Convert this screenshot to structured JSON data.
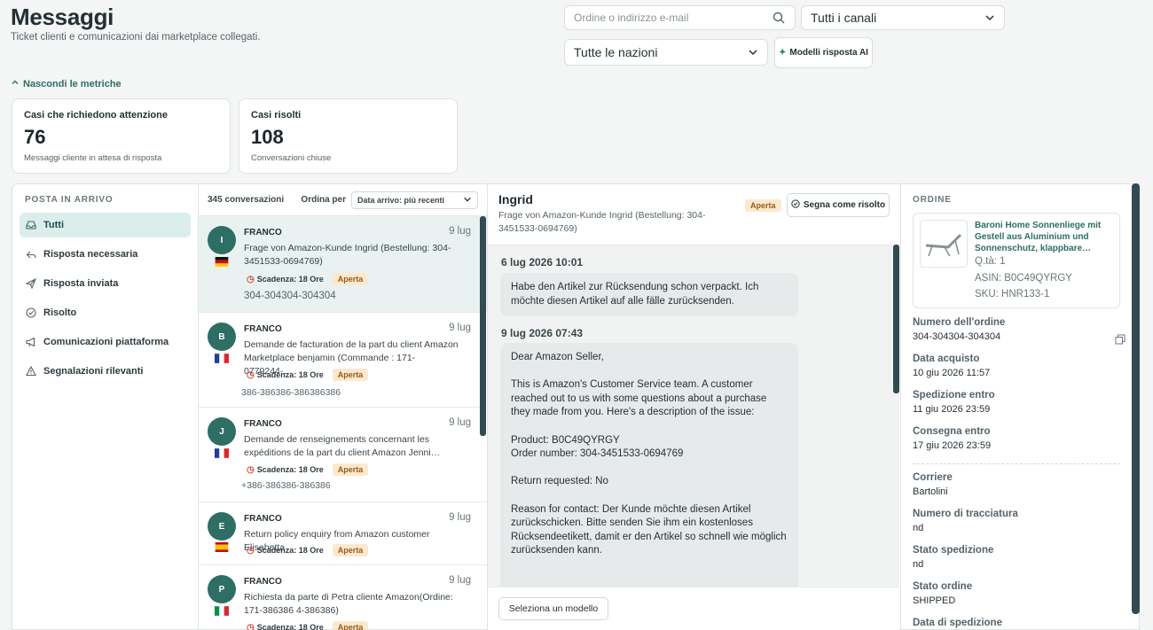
{
  "header": {
    "title": "Messaggi",
    "subtitle": "Ticket clienti e comunicazioni dai marketplace collegati."
  },
  "filters": {
    "search_placeholder": "Ordine o indirizzo e-mail",
    "channel": "Tutti i canali",
    "nation": "Tutte le nazioni",
    "ai_templates": "Modelli risposta AI"
  },
  "metrics_toggle": "Nascondi le metriche",
  "metrics": [
    {
      "title": "Casi che richiedono attenzione",
      "value": "76",
      "desc": "Messaggi cliente in attesa di risposta"
    },
    {
      "title": "Casi risolti",
      "value": "108",
      "desc": "Conversazioni chiuse"
    }
  ],
  "inbox": {
    "heading": "POSTA IN ARRIVO",
    "items": [
      {
        "label": "Tutti",
        "icon": "inbox-icon"
      },
      {
        "label": "Risposta necessaria",
        "icon": "reply-icon"
      },
      {
        "label": "Risposta inviata",
        "icon": "send-icon"
      },
      {
        "label": "Risolto",
        "icon": "check-circle-icon"
      },
      {
        "label": "Comunicazioni piattaforma",
        "icon": "megaphone-icon"
      },
      {
        "label": "Segnalazioni rilevanti",
        "icon": "warning-icon"
      }
    ]
  },
  "list": {
    "count": "345 conversazioni",
    "sort_label": "Ordina per",
    "sort_value": "Data arrivo: più recenti",
    "conversations": [
      {
        "initial": "I",
        "sender": "FRANCO",
        "date": "9 lug",
        "flag": "de",
        "subject": "Frage von Amazon-Kunde Ingrid (Bestellung: 304-3451533-0694769)",
        "deadline": "Scadenza: 18 Ore",
        "status": "Aperta",
        "order": "304-304304-304304"
      },
      {
        "initial": "B",
        "sender": "FRANCO",
        "date": "9 lug",
        "flag": "fr",
        "subject": "Demande de facturation de la part du client Amazon Marketplace benjamin (Commande : 171-0779244-…",
        "deadline": "Scadenza: 18 Ore",
        "status": "Aperta",
        "order": "386-386386-386386386"
      },
      {
        "initial": "J",
        "sender": "FRANCO",
        "date": "9 lug",
        "flag": "fr",
        "subject": "Demande de renseignements concernant les expéditions de la part du client Amazon Jenni…",
        "deadline": "Scadenza: 18 Ore",
        "status": "Aperta",
        "order": "+386-386386-386386"
      },
      {
        "initial": "E",
        "sender": "FRANCO",
        "date": "9 lug",
        "flag": "es",
        "subject": "Return policy enquiry from Amazon customer Elisabetta",
        "deadline": "Scadenza: 18 Ore",
        "status": "Aperta",
        "order": ""
      },
      {
        "initial": "P",
        "sender": "FRANCO",
        "date": "9 lug",
        "flag": "it",
        "subject": "Richiesta da parte di Petra cliente Amazon(Ordine: 171-386386 4-386386)",
        "deadline": "Scadenza: 18 Ore",
        "status": "Aperta",
        "order": ""
      }
    ]
  },
  "thread": {
    "name": "Ingrid",
    "subject": "Frage von Amazon-Kunde Ingrid (Bestellung: 304-3451533-0694769)",
    "status": "Aperta",
    "resolve_label": "Segna come risolto",
    "messages": [
      {
        "date": "6 lug 2026 10:01",
        "text": "Habe den Artikel zur Rücksendung schon verpackt. Ich möchte diesen Artikel auf alle fälle zurücksenden."
      },
      {
        "date": "9 lug 2026 07:43",
        "text": "Dear Amazon Seller,\n\nThis is Amazon's Customer Service team. A customer reached out to us with some questions about a purchase they made from you. Here's a description of the issue:\n\nProduct: B0C49QYRGY\nOrder number: 304-3451533-0694769\n\nReturn requested: No\n\nReason for contact: Der Kunde möchte diesen Artikel zurückschicken. Bitte senden Sie ihm ein kostenloses Rücksendeetikett, damit er den Artikel so schnell wie möglich zurücksenden kann."
      }
    ],
    "template_label": "Seleziona un modello"
  },
  "order": {
    "heading": "ORDINE",
    "product": {
      "title": "Baroni Home Sonnenliege mit Gestell aus Aluminium und Sonnenschutz, klappbare…",
      "qty": "Q.tà: 1",
      "asin": "ASIN: B0C49QYRGY",
      "sku": "SKU: HNR133-1"
    },
    "fields": [
      {
        "label": "Numero dell'ordine",
        "value": "304-304304-304304"
      },
      {
        "label": "Data acquisto",
        "value": "10 giu 2026 11:57"
      },
      {
        "label": "Spedizione entro",
        "value": "11 giu 2026 23:59"
      },
      {
        "label": "Consegna entro",
        "value": "17 giu 2026 23:59"
      },
      {
        "label": "Corriere",
        "value": "Bartolini"
      },
      {
        "label": "Numero di tracciatura",
        "value": "nd"
      },
      {
        "label": "Stato spedizione",
        "value": "nd"
      },
      {
        "label": "Stato ordine",
        "value": "SHIPPED"
      },
      {
        "label": "Data di spedizione",
        "value": ""
      }
    ]
  },
  "colors": {
    "accent": "#2e6e64",
    "open_badge": "#fbe9cf",
    "scrollbar": "#324a52"
  }
}
